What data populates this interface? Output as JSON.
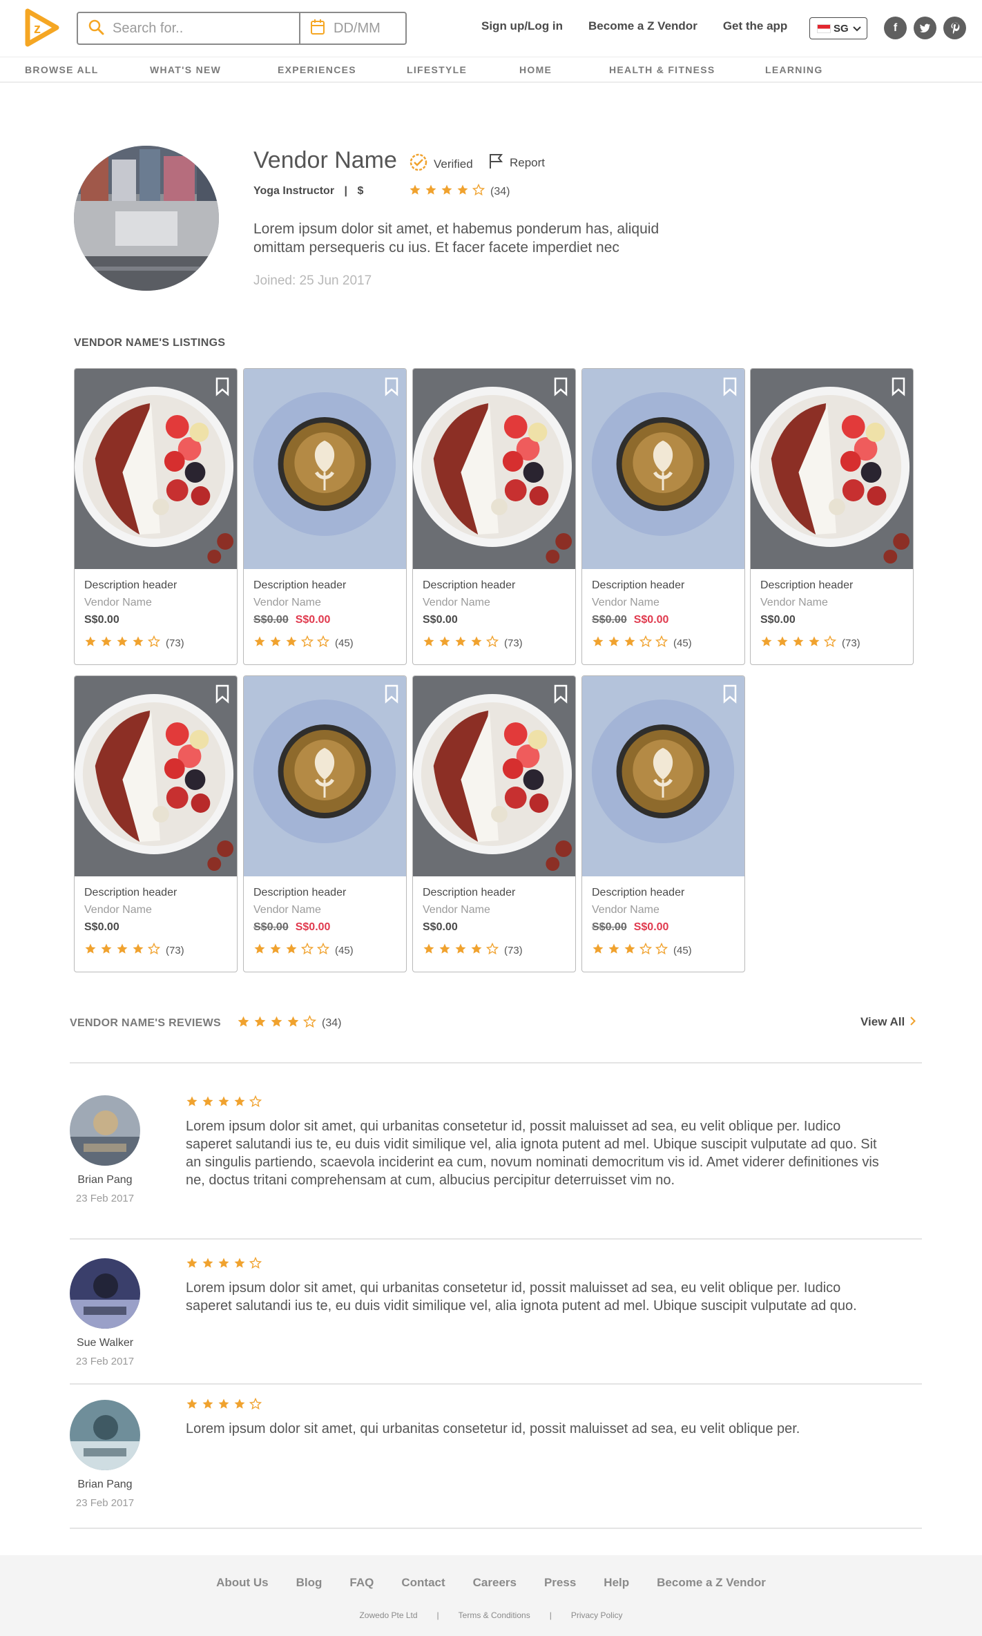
{
  "header": {
    "search_placeholder": "Search for..",
    "date_placeholder": "DD/MM",
    "links": [
      "Sign up/Log in",
      "Become a Z Vendor",
      "Get the app"
    ],
    "country": "SG",
    "social": [
      "facebook-icon",
      "twitter-icon",
      "pinterest-icon"
    ],
    "brand_color": "#f5a623"
  },
  "categories": [
    "BROWSE ALL",
    "WHAT'S NEW",
    "EXPERIENCES",
    "LIFESTYLE",
    "HOME",
    "HEALTH & FITNESS",
    "LEARNING"
  ],
  "vendor": {
    "name": "Vendor Name",
    "verified": "Verified",
    "report": "Report",
    "category": "Yoga Instructor",
    "separator": "|",
    "price_level": "$",
    "rating": 4,
    "rating_count": "(34)",
    "bio": "Lorem ipsum dolor sit amet, et habemus ponderum has, aliquid omittam persequeris cu ius. Et facer facete imperdiet nec",
    "joined": "Joined: 25 Jun 2017"
  },
  "listings": {
    "title": "VENDOR NAME'S LISTINGS",
    "items": [
      {
        "image": "acai-bowl",
        "header": "Description header",
        "vendor": "Vendor Name",
        "price": "S$0.00",
        "sale_price": "",
        "rating": 4,
        "count": "(73)"
      },
      {
        "image": "latte",
        "header": "Description header",
        "vendor": "Vendor Name",
        "price": "S$0.00",
        "sale_price": "S$0.00",
        "rating": 3,
        "count": "(45)"
      },
      {
        "image": "acai-bowl",
        "header": "Description header",
        "vendor": "Vendor Name",
        "price": "S$0.00",
        "sale_price": "",
        "rating": 4,
        "count": "(73)"
      },
      {
        "image": "latte",
        "header": "Description header",
        "vendor": "Vendor Name",
        "price": "S$0.00",
        "sale_price": "S$0.00",
        "rating": 3,
        "count": "(45)"
      },
      {
        "image": "acai-bowl",
        "header": "Description header",
        "vendor": "Vendor Name",
        "price": "S$0.00",
        "sale_price": "",
        "rating": 4,
        "count": "(73)"
      },
      {
        "image": "acai-bowl",
        "header": "Description header",
        "vendor": "Vendor Name",
        "price": "S$0.00",
        "sale_price": "",
        "rating": 4,
        "count": "(73)"
      },
      {
        "image": "latte",
        "header": "Description header",
        "vendor": "Vendor Name",
        "price": "S$0.00",
        "sale_price": "S$0.00",
        "rating": 3,
        "count": "(45)"
      },
      {
        "image": "acai-bowl",
        "header": "Description header",
        "vendor": "Vendor Name",
        "price": "S$0.00",
        "sale_price": "",
        "rating": 4,
        "count": "(73)"
      },
      {
        "image": "latte",
        "header": "Description header",
        "vendor": "Vendor Name",
        "price": "S$0.00",
        "sale_price": "S$0.00",
        "rating": 3,
        "count": "(45)"
      }
    ]
  },
  "reviews": {
    "title": "VENDOR NAME'S REVIEWS",
    "rating": 4,
    "count": "(34)",
    "view_all": "View All",
    "items": [
      {
        "name": "Brian Pang",
        "date": "23 Feb 2017",
        "rating": 4,
        "text": "Lorem ipsum dolor sit amet, qui urbanitas consetetur id, possit maluisset ad sea, eu velit oblique per. Iudico saperet salutandi ius te, eu duis vidit similique vel, alia ignota putent ad mel. Ubique suscipit vulputate ad quo. Sit an singulis partiendo, scaevola inciderint ea cum, novum nominati democritum vis id. Amet viderer definitiones vis ne, doctus tritani comprehensam at cum, albucius percipitur deterruisset vim no."
      },
      {
        "name": "Sue Walker",
        "date": "23 Feb 2017",
        "rating": 4,
        "text": "Lorem ipsum dolor sit amet, qui urbanitas consetetur id, possit maluisset ad sea, eu velit oblique per. Iudico saperet salutandi ius te, eu duis vidit similique vel, alia ignota putent ad mel. Ubique suscipit vulputate ad quo."
      },
      {
        "name": "Brian Pang",
        "date": "23 Feb 2017",
        "rating": 4,
        "text": "Lorem ipsum dolor sit amet, qui urbanitas consetetur id, possit maluisset ad sea, eu velit oblique per."
      }
    ]
  },
  "footer": {
    "links": [
      "About Us",
      "Blog",
      "FAQ",
      "Contact",
      "Careers",
      "Press",
      "Help",
      "Become a Z Vendor"
    ],
    "legal": [
      "Zowedo Pte Ltd",
      "|",
      "Terms & Conditions",
      "|",
      "Privacy Policy"
    ]
  },
  "colors": {
    "star": "#f0a22e",
    "sale": "#e03a4e",
    "accent": "#f5a623"
  }
}
